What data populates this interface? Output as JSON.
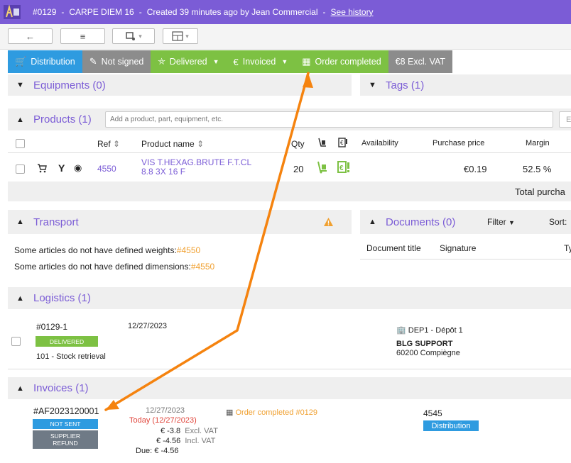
{
  "topbar": {
    "order_ref": "#0129",
    "customer": "CARPE DIEM 16",
    "created": "Created 39 minutes ago by Jean Commercial",
    "separator": "-",
    "history_link": "See history"
  },
  "toolbar": {
    "back_icon": "arrow-left-icon",
    "list_icon": "list-icon",
    "dropdown_caret": "▾"
  },
  "statusbar": [
    {
      "label": "Distribution",
      "color": "#2e9be0",
      "icon": "cart-icon",
      "has_caret": false
    },
    {
      "label": "Not signed",
      "color": "#8c8c8c",
      "icon": "edit-icon",
      "has_caret": false
    },
    {
      "label": "Delivered",
      "color": "#7dc143",
      "icon": "dolly-icon",
      "has_caret": true
    },
    {
      "label": "Invoiced",
      "color": "#7dc143",
      "icon": "invoice-icon",
      "has_caret": true
    },
    {
      "label": "Order completed",
      "color": "#7dc143",
      "icon": "calculator-icon",
      "has_caret": false
    },
    {
      "label": "€8 Excl. VAT",
      "color": "#8c8c8c",
      "icon": "",
      "has_caret": false
    }
  ],
  "equipments": {
    "title": "Equipments (0)"
  },
  "tags": {
    "title": "Tags (1)"
  },
  "products": {
    "title": "Products (1)",
    "search_placeholder": "Add a product, part, equipment, etc.",
    "button_partial": "E",
    "columns": {
      "ref": "Ref",
      "name": "Product name",
      "qty": "Qty",
      "availability": "Availability",
      "purchase_price": "Purchase price",
      "margin": "Margin"
    },
    "sort_icon": "⇕",
    "rows": [
      {
        "ref": "4550",
        "name_line1": "VIS T.HEXAG.BRUTE F.T.CL",
        "name_line2": "8.8 3X 16 F",
        "qty": "20",
        "availability": "",
        "purchase_price": "€0.19",
        "margin": "52.5 %"
      }
    ],
    "total_label": "Total purcha"
  },
  "transport": {
    "title": "Transport",
    "warning_icon": "warning-icon",
    "lines": [
      {
        "text": "Some articles do not have defined weights:",
        "link": "#4550"
      },
      {
        "text": "Some articles do not have defined dimensions:",
        "link": "#4550"
      }
    ]
  },
  "documents": {
    "title": "Documents (0)",
    "filter_label": "Filter",
    "sort_label": "Sort:",
    "col_title": "Document title",
    "col_signature": "Signature",
    "col_type": "Ty"
  },
  "logistics": {
    "title": "Logistics (1)",
    "entry": {
      "ref": "#0129-1",
      "date": "12/27/2023",
      "status": "DELIVERED",
      "type": "101 - Stock retrieval",
      "depot": "DEP1 - Dépôt 1",
      "company": "BLG SUPPORT",
      "city": "60200 Compiègne"
    }
  },
  "invoices": {
    "title": "Invoices (1)",
    "entry": {
      "ref": "#AF2023120001",
      "status1": "NOT SENT",
      "status2_line1": "SUPPLIER",
      "status2_line2": "REFUND",
      "date": "12/27/2023",
      "today": "Today (12/27/2023)",
      "excl_amount": "€ -3.8",
      "excl_label": "Excl. VAT",
      "incl_amount": "€ -4.56",
      "incl_label": "Incl. VAT",
      "due": "Due: € -4.56",
      "order_link": "Order completed #0129",
      "account": "4545",
      "channel": "Distribution"
    }
  },
  "annotation": {
    "arrow_color": "#f5830f"
  }
}
